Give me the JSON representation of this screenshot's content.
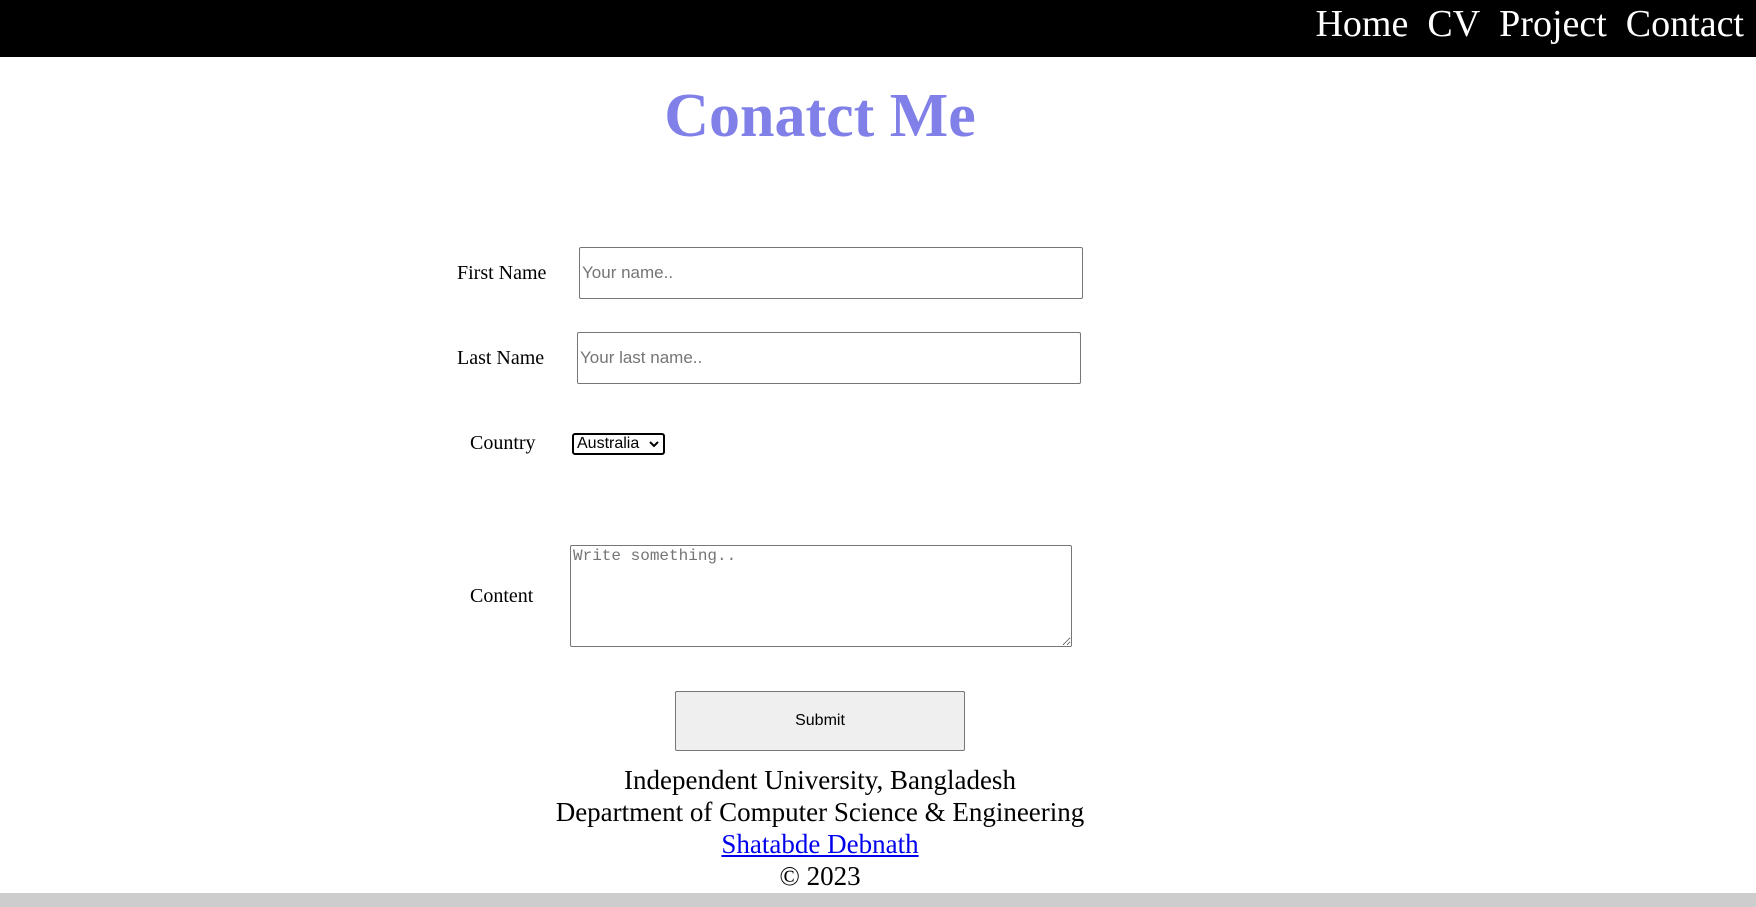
{
  "nav": {
    "items": [
      {
        "label": "Home"
      },
      {
        "label": "CV"
      },
      {
        "label": "Project"
      },
      {
        "label": "Contact"
      }
    ]
  },
  "page": {
    "title": "Conatct Me"
  },
  "form": {
    "first_name": {
      "label": "First Name",
      "placeholder": "Your name..",
      "value": ""
    },
    "last_name": {
      "label": "Last Name",
      "placeholder": "Your last name..",
      "value": ""
    },
    "country": {
      "label": "Country",
      "selected": "Australia"
    },
    "content": {
      "label": "Content",
      "placeholder": "Write something..",
      "value": ""
    },
    "submit_label": "Submit"
  },
  "footer": {
    "university": "Independent University, Bangladesh",
    "department": "Department of Computer Science & Engineering",
    "author": "Shatabde Debnath",
    "copyright": "© 2023"
  },
  "colors": {
    "nav_background": "#000000",
    "title": "#8080e8",
    "link": "#0000ee"
  }
}
